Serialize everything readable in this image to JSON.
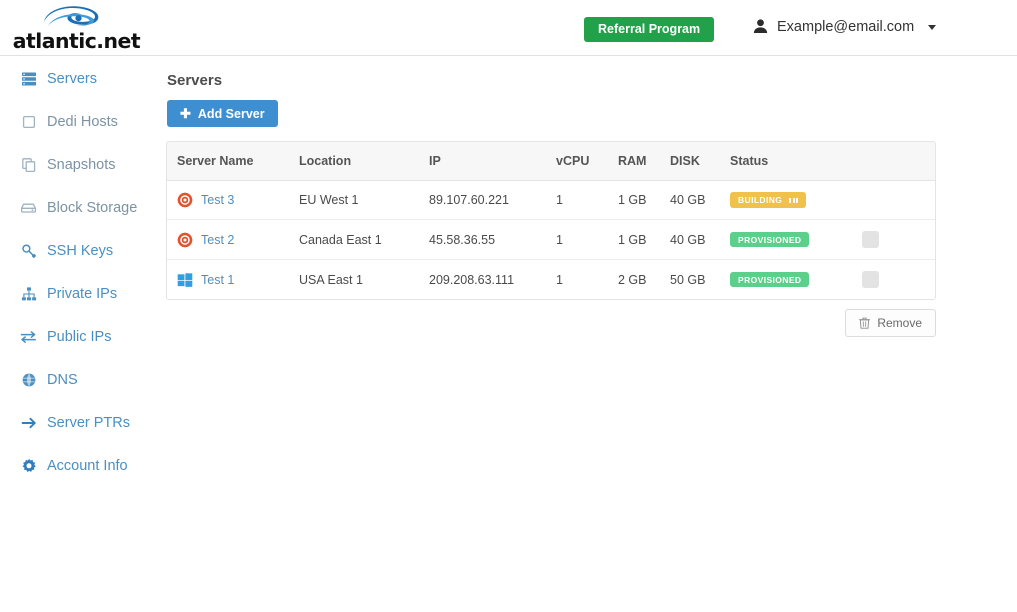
{
  "header": {
    "logo_text": "atlantic.net",
    "logo_icon": "swirl-icon",
    "referral_label": "Referral Program",
    "referral_color": "#21a14a",
    "account_email": "Example@email.com",
    "account_icon": "user-icon",
    "caret_icon": "chevron-down-icon"
  },
  "sidebar": {
    "items": [
      {
        "label": "Servers",
        "icon": "server-icon",
        "active": true
      },
      {
        "label": "Dedi Hosts",
        "icon": "box-icon",
        "active": false
      },
      {
        "label": "Snapshots",
        "icon": "copy-icon",
        "active": false
      },
      {
        "label": "Block Storage",
        "icon": "hdd-icon",
        "active": false
      },
      {
        "label": "SSH Keys",
        "icon": "key-icon",
        "active": false
      },
      {
        "label": "Private IPs",
        "icon": "sitemap-icon",
        "active": false
      },
      {
        "label": "Public IPs",
        "icon": "exchange-icon",
        "active": false
      },
      {
        "label": "DNS",
        "icon": "globe-icon",
        "active": false
      },
      {
        "label": "Server PTRs",
        "icon": "arrow-right-icon",
        "active": false
      },
      {
        "label": "Account Info",
        "icon": "gear-icon",
        "active": false
      }
    ]
  },
  "main": {
    "page_title": "Servers",
    "add_server_label": "Add Server",
    "add_server_color": "#3d8fd1",
    "remove_label": "Remove",
    "remove_icon": "trash-icon",
    "columns": [
      "Server Name",
      "Location",
      "IP",
      "vCPU",
      "RAM",
      "DISK",
      "Status",
      ""
    ],
    "rows": [
      {
        "name": "Test 3",
        "os_icon": "centos-icon",
        "location": "EU West 1",
        "ip": "89.107.60.221",
        "vcpu": "1",
        "ram": "1 GB",
        "disk": "40 GB",
        "status": "BUILDING",
        "status_type": "building",
        "status_color": "#f0c14b",
        "checkbox": false
      },
      {
        "name": "Test 2",
        "os_icon": "centos-icon",
        "location": "Canada East 1",
        "ip": "45.58.36.55",
        "vcpu": "1",
        "ram": "1 GB",
        "disk": "40 GB",
        "status": "PROVISIONED",
        "status_type": "provisioned",
        "status_color": "#5cd08a",
        "checkbox": true
      },
      {
        "name": "Test 1",
        "os_icon": "windows-icon",
        "location": "USA East 1",
        "ip": "209.208.63.111",
        "vcpu": "1",
        "ram": "2 GB",
        "disk": "50 GB",
        "status": "PROVISIONED",
        "status_type": "provisioned",
        "status_color": "#5cd08a",
        "checkbox": true
      }
    ]
  }
}
